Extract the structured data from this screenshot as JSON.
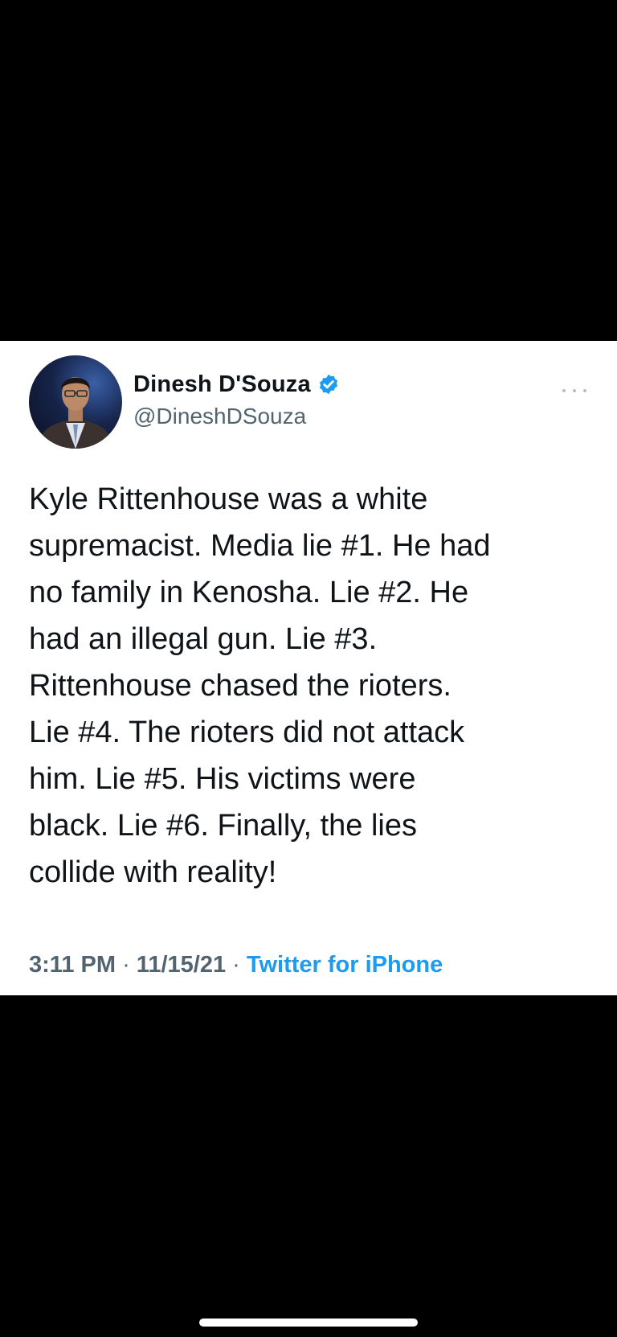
{
  "tweet": {
    "author": {
      "display_name": "Dinesh D'Souza",
      "handle": "@DineshDSouza",
      "verified": true,
      "avatar_icon": "profile-photo"
    },
    "text": "Kyle Rittenhouse was a white\nsupremacist. Media lie #1. He had\nno family in Kenosha. Lie #2. He\nhad an illegal gun. Lie #3.\nRittenhouse chased the rioters.\nLie #4. The rioters did not attack\nhim. Lie #5. His victims were\nblack. Lie #6. Finally, the lies\ncollide with reality!",
    "time": "3:11 PM",
    "date": "11/15/21",
    "separator": "·",
    "source": "Twitter for iPhone"
  },
  "icons": {
    "verified": "verified-badge-icon",
    "more": "more-options-icon"
  },
  "colors": {
    "background": "#000000",
    "card": "#ffffff",
    "text": "#0f1419",
    "secondary": "#536471",
    "accent": "#1d9bf0"
  }
}
